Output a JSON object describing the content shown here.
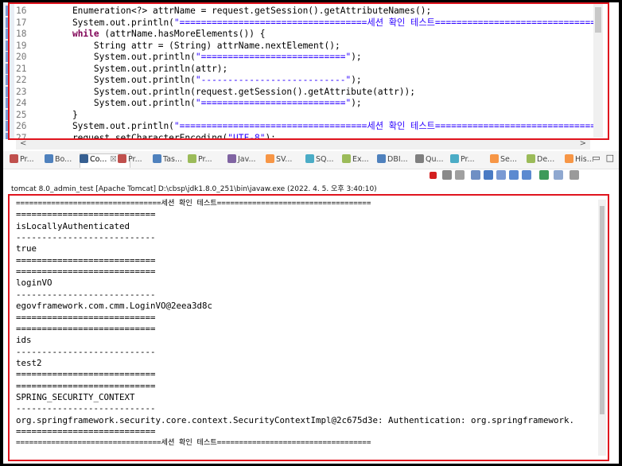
{
  "editor": {
    "lines": [
      {
        "num": "16",
        "parts": [
          {
            "t": "    Enumeration<?> attrName = request.getSession().getAttributeNames();",
            "c": ""
          }
        ]
      },
      {
        "num": "17",
        "parts": [
          {
            "t": "    System.out.println(",
            "c": ""
          },
          {
            "t": "\"===================================세션 확인 테스트===============================",
            "c": "str"
          }
        ]
      },
      {
        "num": "18",
        "parts": [
          {
            "t": "    ",
            "c": ""
          },
          {
            "t": "while",
            "c": "kw"
          },
          {
            "t": " (attrName.hasMoreElements()) {",
            "c": ""
          }
        ]
      },
      {
        "num": "19",
        "parts": [
          {
            "t": "        String attr = (String) attrName.nextElement();",
            "c": ""
          }
        ]
      },
      {
        "num": "20",
        "parts": [
          {
            "t": "        System.out.println(",
            "c": ""
          },
          {
            "t": "\"===========================\"",
            "c": "str"
          },
          {
            "t": ");",
            "c": ""
          }
        ]
      },
      {
        "num": "21",
        "parts": [
          {
            "t": "        System.out.println(attr);",
            "c": ""
          }
        ]
      },
      {
        "num": "22",
        "parts": [
          {
            "t": "        System.out.println(",
            "c": ""
          },
          {
            "t": "\"---------------------------\"",
            "c": "str"
          },
          {
            "t": ");",
            "c": ""
          }
        ]
      },
      {
        "num": "23",
        "parts": [
          {
            "t": "        System.out.println(request.getSession().getAttribute(attr));",
            "c": ""
          }
        ]
      },
      {
        "num": "24",
        "parts": [
          {
            "t": "        System.out.println(",
            "c": ""
          },
          {
            "t": "\"===========================\"",
            "c": "str"
          },
          {
            "t": ");",
            "c": ""
          }
        ]
      },
      {
        "num": "25",
        "parts": [
          {
            "t": "    }",
            "c": ""
          }
        ]
      },
      {
        "num": "26",
        "parts": [
          {
            "t": "    System.out.println(",
            "c": ""
          },
          {
            "t": "\"===================================세션 확인 테스트===============================",
            "c": "str"
          }
        ]
      },
      {
        "num": "27",
        "parts": [
          {
            "t": "    request.setCharacterEncoding(",
            "c": ""
          },
          {
            "t": "\"UTF-8\"",
            "c": "str"
          },
          {
            "t": ");",
            "c": ""
          }
        ]
      }
    ]
  },
  "tabs": [
    {
      "label": "Pr...",
      "icon": "problems-icon",
      "color": "#c0504d"
    },
    {
      "label": "Bo...",
      "icon": "bookmarks-icon",
      "color": "#4f81bd"
    },
    {
      "label": "Co...",
      "icon": "console-icon",
      "color": "#365f91"
    },
    {
      "label": "Pr...",
      "icon": "progress-icon",
      "color": "#c0504d"
    },
    {
      "label": "Tas...",
      "icon": "tasks-icon",
      "color": "#4f81bd"
    },
    {
      "label": "Pr...",
      "icon": "properties-icon",
      "color": "#9bbb59"
    },
    {
      "label": "Jav...",
      "icon": "javadoc-icon",
      "color": "#8064a2"
    },
    {
      "label": "SV...",
      "icon": "svn-icon",
      "color": "#f79646"
    },
    {
      "label": "SQ...",
      "icon": "sql-icon",
      "color": "#4bacc6"
    },
    {
      "label": "Ex...",
      "icon": "explorer-icon",
      "color": "#9bbb59"
    },
    {
      "label": "DBI...",
      "icon": "dbi-icon",
      "color": "#4f81bd"
    },
    {
      "label": "Qu...",
      "icon": "query-icon",
      "color": "#7f7f7f"
    },
    {
      "label": "Pr...",
      "icon": "project-icon",
      "color": "#4bacc6"
    },
    {
      "label": "Se...",
      "icon": "search-icon",
      "color": "#f79646"
    },
    {
      "label": "De...",
      "icon": "debug-icon",
      "color": "#9bbb59"
    },
    {
      "label": "His...",
      "icon": "history-icon",
      "color": "#f79646"
    }
  ],
  "tab_close": "☒",
  "console": {
    "title": "tomcat 8.0_admin_test [Apache Tomcat] D:\\cbsp\\jdk1.8.0_251\\bin\\javaw.exe (2022. 4. 5. 오후 3:40:10)",
    "lines": [
      {
        "t": "=================================세션 확인 테스트===================================",
        "sm": true
      },
      {
        "t": "===========================",
        "sm": false
      },
      {
        "t": "isLocallyAuthenticated",
        "sm": false
      },
      {
        "t": "---------------------------",
        "sm": false
      },
      {
        "t": "true",
        "sm": false
      },
      {
        "t": "===========================",
        "sm": false
      },
      {
        "t": "===========================",
        "sm": false
      },
      {
        "t": "loginVO",
        "sm": false
      },
      {
        "t": "---------------------------",
        "sm": false
      },
      {
        "t": "egovframework.com.cmm.LoginVO@2eea3d8c",
        "sm": false
      },
      {
        "t": "===========================",
        "sm": false
      },
      {
        "t": "===========================",
        "sm": false
      },
      {
        "t": "ids",
        "sm": false
      },
      {
        "t": "---------------------------",
        "sm": false
      },
      {
        "t": "test2",
        "sm": false
      },
      {
        "t": "===========================",
        "sm": false
      },
      {
        "t": "===========================",
        "sm": false
      },
      {
        "t": "SPRING_SECURITY_CONTEXT",
        "sm": false
      },
      {
        "t": "---------------------------",
        "sm": false
      },
      {
        "t": "org.springframework.security.core.context.SecurityContextImpl@2c675d3e: Authentication: org.springframework.",
        "sm": false
      },
      {
        "t": "===========================",
        "sm": false
      },
      {
        "t": "=================================세션 확인 테스트===================================",
        "sm": true
      }
    ]
  },
  "colors": {
    "highlight_box": "#e0141e",
    "string": "#2a00ff",
    "keyword": "#7f0055"
  }
}
